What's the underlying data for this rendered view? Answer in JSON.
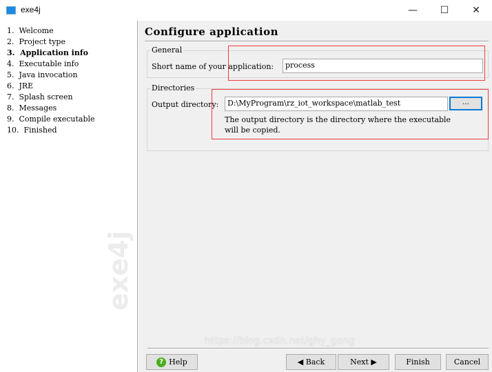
{
  "window": {
    "title": "exe4j",
    "minimize": "—",
    "maximize": "☐",
    "close": "✕"
  },
  "sidebar": {
    "steps": [
      {
        "label": "1.  Welcome"
      },
      {
        "label": "2.  Project type"
      },
      {
        "label": "3.  Application info",
        "current": true
      },
      {
        "label": "4.  Executable info"
      },
      {
        "label": "5.  Java invocation"
      },
      {
        "label": "6.  JRE"
      },
      {
        "label": "7.  Splash screen"
      },
      {
        "label": "8.  Messages"
      },
      {
        "label": "9.  Compile executable"
      },
      {
        "label": "10.  Finished"
      }
    ],
    "logo": "exe4j"
  },
  "main": {
    "title": "Configure application",
    "general": {
      "legend": "General",
      "short_name_label": "Short name of your application:",
      "short_name_value": "process"
    },
    "directories": {
      "legend": "Directories",
      "output_label": "Output directory:",
      "output_value": "D:\\MyProgram\\rz_iot_workspace\\matlab_test",
      "browse_label": "...",
      "hint_line1": "The output directory is the directory where the executable",
      "hint_line2": "will be copied."
    }
  },
  "buttons": {
    "help": "Help",
    "back": "Back",
    "next": "Next",
    "finish": "Finish",
    "cancel": "Cancel"
  },
  "watermark": "https://blog.csdn.net/ghy_gong",
  "colors": {
    "highlight": "#ec3b3b",
    "focus": "#0a78d7"
  }
}
